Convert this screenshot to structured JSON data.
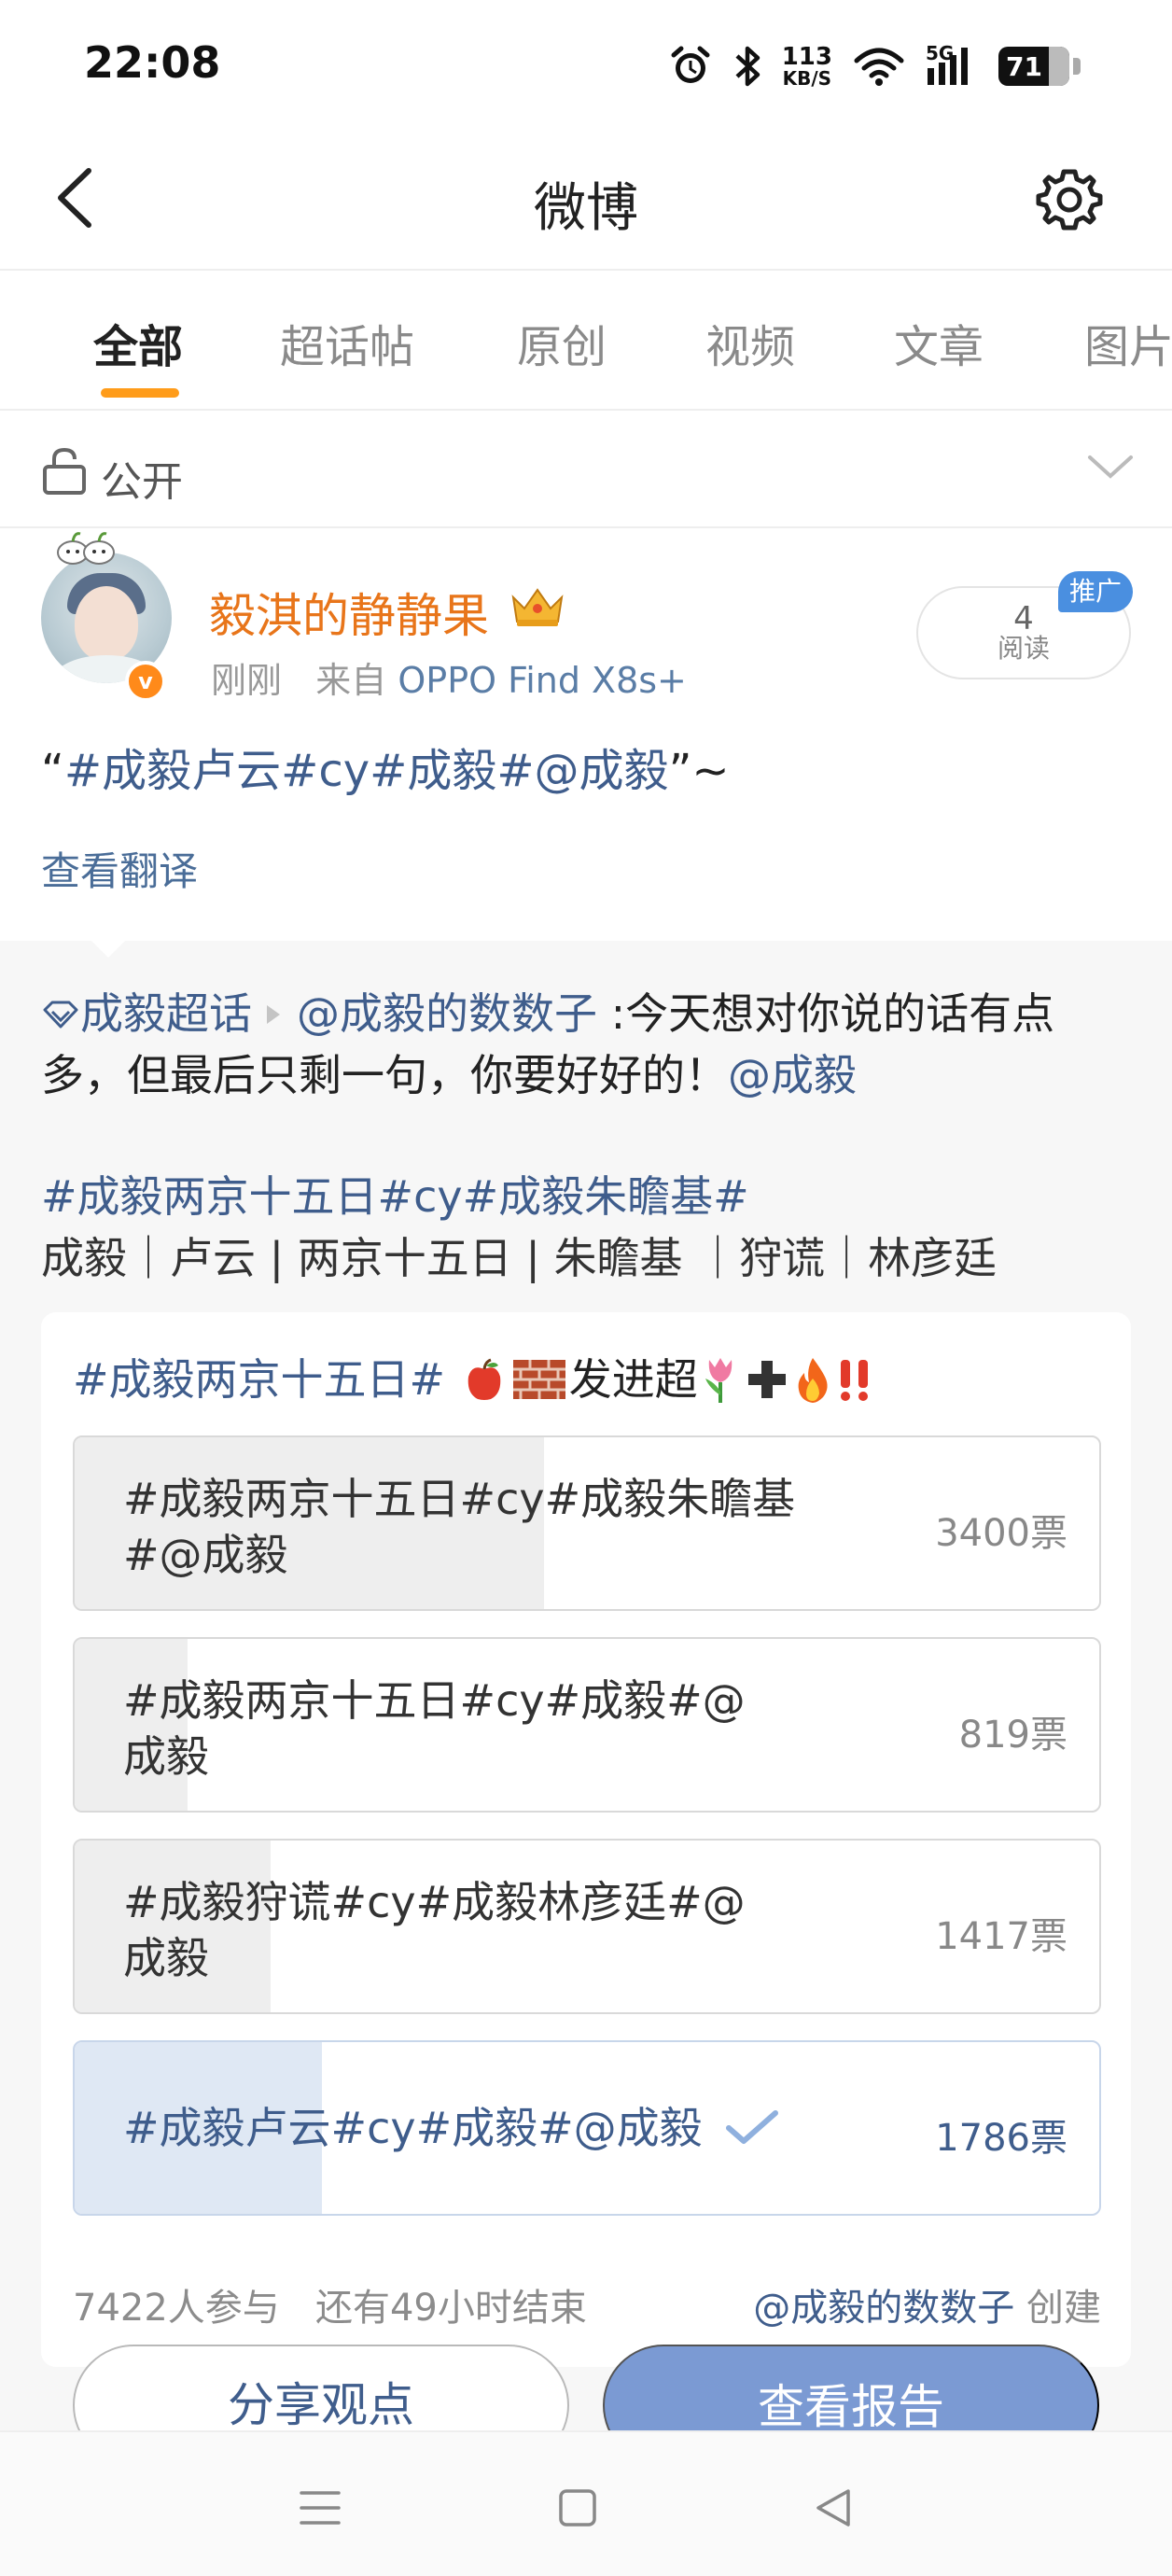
{
  "status_bar": {
    "time": "22:08",
    "net_speed_value": "113",
    "net_speed_unit": "KB/S",
    "signal_label": "5G",
    "battery": "71",
    "icons": [
      "alarm-icon",
      "bluetooth-icon",
      "wifi-icon",
      "cell-signal-icon",
      "battery-icon"
    ]
  },
  "header": {
    "title": "微博",
    "back_icon": "chevron-left-icon",
    "settings_icon": "gear-icon"
  },
  "tabs": [
    {
      "label": "全部",
      "active": true
    },
    {
      "label": "超话帖",
      "active": false
    },
    {
      "label": "原创",
      "active": false
    },
    {
      "label": "视频",
      "active": false
    },
    {
      "label": "文章",
      "active": false
    },
    {
      "label": "图片",
      "active": false
    }
  ],
  "visibility": {
    "label": "公开"
  },
  "post": {
    "username": "毅淇的静静果",
    "time": "刚刚",
    "source_prefix": "来自",
    "device": "OPPO Find X8s+",
    "verified_badge": "v",
    "read_count": "4",
    "read_label": "阅读",
    "promo_tag": "推广",
    "body_open_quote": "“",
    "body_tags": "#成毅卢云#cy#成毅#@成毅",
    "body_close": "”~",
    "translate": "查看翻译"
  },
  "repost": {
    "supertopic": "成毅超话",
    "author": "@成毅的数数子",
    "text_line1": ":今天想对你说的话有点",
    "text_line2_plain": "多，但最后只剩一句，你要好好的！",
    "text_line2_mention": "@成毅",
    "tags_line": "#成毅两京十五日#cy#成毅朱瞻基#",
    "names_line": "成毅｜卢云 | 两京十五日 | 朱瞻基 ｜狩谎｜林彦廷"
  },
  "poll": {
    "title_tag": "#成毅两京十五日#",
    "title_text": "发进超",
    "options": [
      {
        "text": "#成毅两京十五日#cy#成毅朱瞻基#@成毅",
        "votes": "3400票",
        "ratio": 0.458,
        "chosen": false
      },
      {
        "text": "#成毅两京十五日#cy#成毅#@成毅",
        "votes": "819票",
        "ratio": 0.11,
        "chosen": false
      },
      {
        "text": "#成毅狩谎#cy#成毅林彦廷#@成毅",
        "votes": "1417票",
        "ratio": 0.191,
        "chosen": false
      },
      {
        "text": "#成毅卢云#cy#成毅#@成毅",
        "votes": "1786票",
        "ratio": 0.241,
        "chosen": true
      }
    ],
    "participants": "7422人参与",
    "time_left": "还有49小时结束",
    "creator": "@成毅的数数子",
    "creator_suffix": "创建",
    "share_button": "分享观点",
    "report_button": "查看报告"
  },
  "nav_bar": {
    "icons": [
      "menu-icon",
      "home-square-icon",
      "back-triangle-icon"
    ]
  },
  "colors": {
    "accent_orange": "#ff9c1a",
    "link_blue": "#3f5d8c",
    "username_orange": "#e8751a",
    "report_button": "#7b9ad3"
  }
}
